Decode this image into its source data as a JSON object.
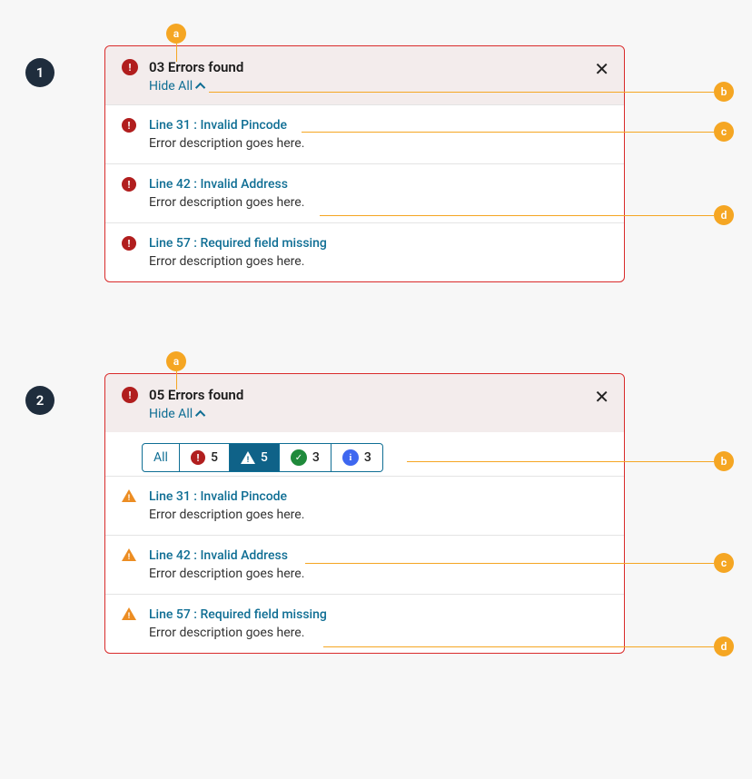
{
  "colors": {
    "error": "#b11e1e",
    "warn": "#ec8d23",
    "success": "#1f8a3b",
    "info": "#3e67f0",
    "link": "#0f6e94",
    "primarySeg": "#0f6288",
    "callout": "#f5a623",
    "stepBadge": "#1f2d3d"
  },
  "example1": {
    "step": "1",
    "header": "03 Errors found",
    "hideAll": "Hide All",
    "items": [
      {
        "link": "Line 31 : Invalid Pincode",
        "desc": "Error description goes here."
      },
      {
        "link": "Line 42 : Invalid Address",
        "desc": "Error description goes here."
      },
      {
        "link": "Line 57 : Required field missing",
        "desc": "Error description goes here."
      }
    ],
    "callouts": {
      "a": "a",
      "b": "b",
      "c": "c",
      "d": "d"
    }
  },
  "example2": {
    "step": "2",
    "header": "05 Errors found",
    "hideAll": "Hide All",
    "filters": {
      "all": "All",
      "errorCount": "5",
      "warnCount": "5",
      "successCount": "3",
      "infoCount": "3"
    },
    "items": [
      {
        "link": "Line 31 : Invalid Pincode",
        "desc": "Error description goes here."
      },
      {
        "link": "Line 42 : Invalid Address",
        "desc": "Error description goes here."
      },
      {
        "link": "Line 57 : Required field missing",
        "desc": "Error description goes here."
      }
    ],
    "callouts": {
      "a": "a",
      "b": "b",
      "c": "c",
      "d": "d"
    }
  }
}
